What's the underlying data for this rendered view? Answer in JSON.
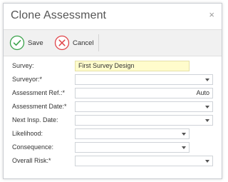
{
  "dialog": {
    "title": "Clone Assessment",
    "close_glyph": "×"
  },
  "toolbar": {
    "save_label": "Save",
    "cancel_label": "Cancel",
    "save_icon": "check-circle-icon",
    "cancel_icon": "x-circle-icon",
    "save_color": "#3aa24a",
    "cancel_color": "#e0454a"
  },
  "form": {
    "survey_label": "Survey:",
    "survey_value": "First Survey Design",
    "surveyor_label": "Surveyor:*",
    "surveyor_value": "",
    "assessment_ref_label": "Assessment Ref.:*",
    "assessment_ref_value": "Auto",
    "assessment_date_label": "Assessment Date:*",
    "assessment_date_value": "",
    "next_insp_label": "Next Insp. Date:",
    "next_insp_value": "",
    "likelihood_label": "Likelihood:",
    "likelihood_value": "",
    "consequence_label": "Consequence:",
    "consequence_value": "",
    "overall_risk_label": "Overall Risk:*",
    "overall_risk_value": ""
  }
}
